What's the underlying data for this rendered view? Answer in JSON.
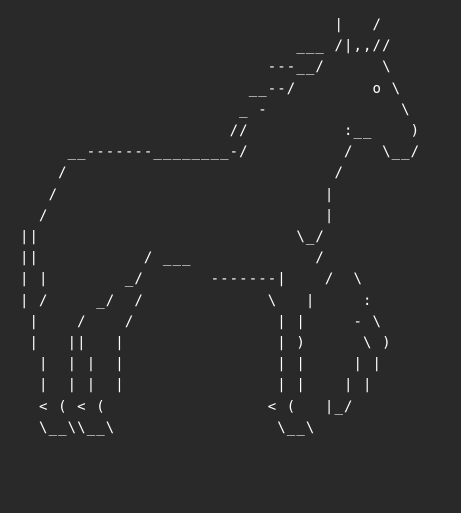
{
  "art": {
    "subject": "horse",
    "color": "#ffffff",
    "background": "#292929",
    "lines": [
      "                                 |   /",
      "                             ___ /|,,//",
      "                          ---__/      \\",
      "                        __--/        o \\",
      "                       _ -              \\",
      "                      //          :__    )",
      "     __-------________-/          /   \\__/",
      "    /                            /",
      "   /                            |",
      "  /                             |",
      "||                           \\_/",
      "||           / ___             /",
      "| |        _/       -------|    /  \\",
      "| /     _/  /             \\   |     :",
      " |    /    /               | |     - \\",
      " |   ||   |                | )      \\ )",
      "  |  | |  |                | |     | |",
      "  |  | |  |                | |    | |",
      "  < ( < (                 < (   |_/",
      "  \\__\\\\__\\                 \\__\\"
    ]
  }
}
